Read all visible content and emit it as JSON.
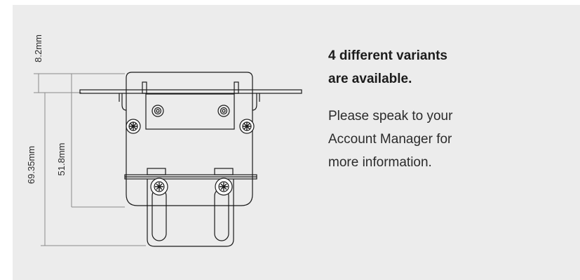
{
  "figure": {
    "dimensions": {
      "top_offset": "8.2mm",
      "overall_height": "69.35mm",
      "inner_height": "51.8mm"
    }
  },
  "info": {
    "heading_lines": [
      "4 different variants",
      "are available."
    ],
    "body_lines": [
      "Please speak to your",
      "Account Manager for",
      "more information."
    ]
  },
  "colors": {
    "card_background": "#ececec",
    "line_art": "#1a1a1a",
    "dimension_lines": "#8a8a8a",
    "text": "#2b2b2b"
  }
}
